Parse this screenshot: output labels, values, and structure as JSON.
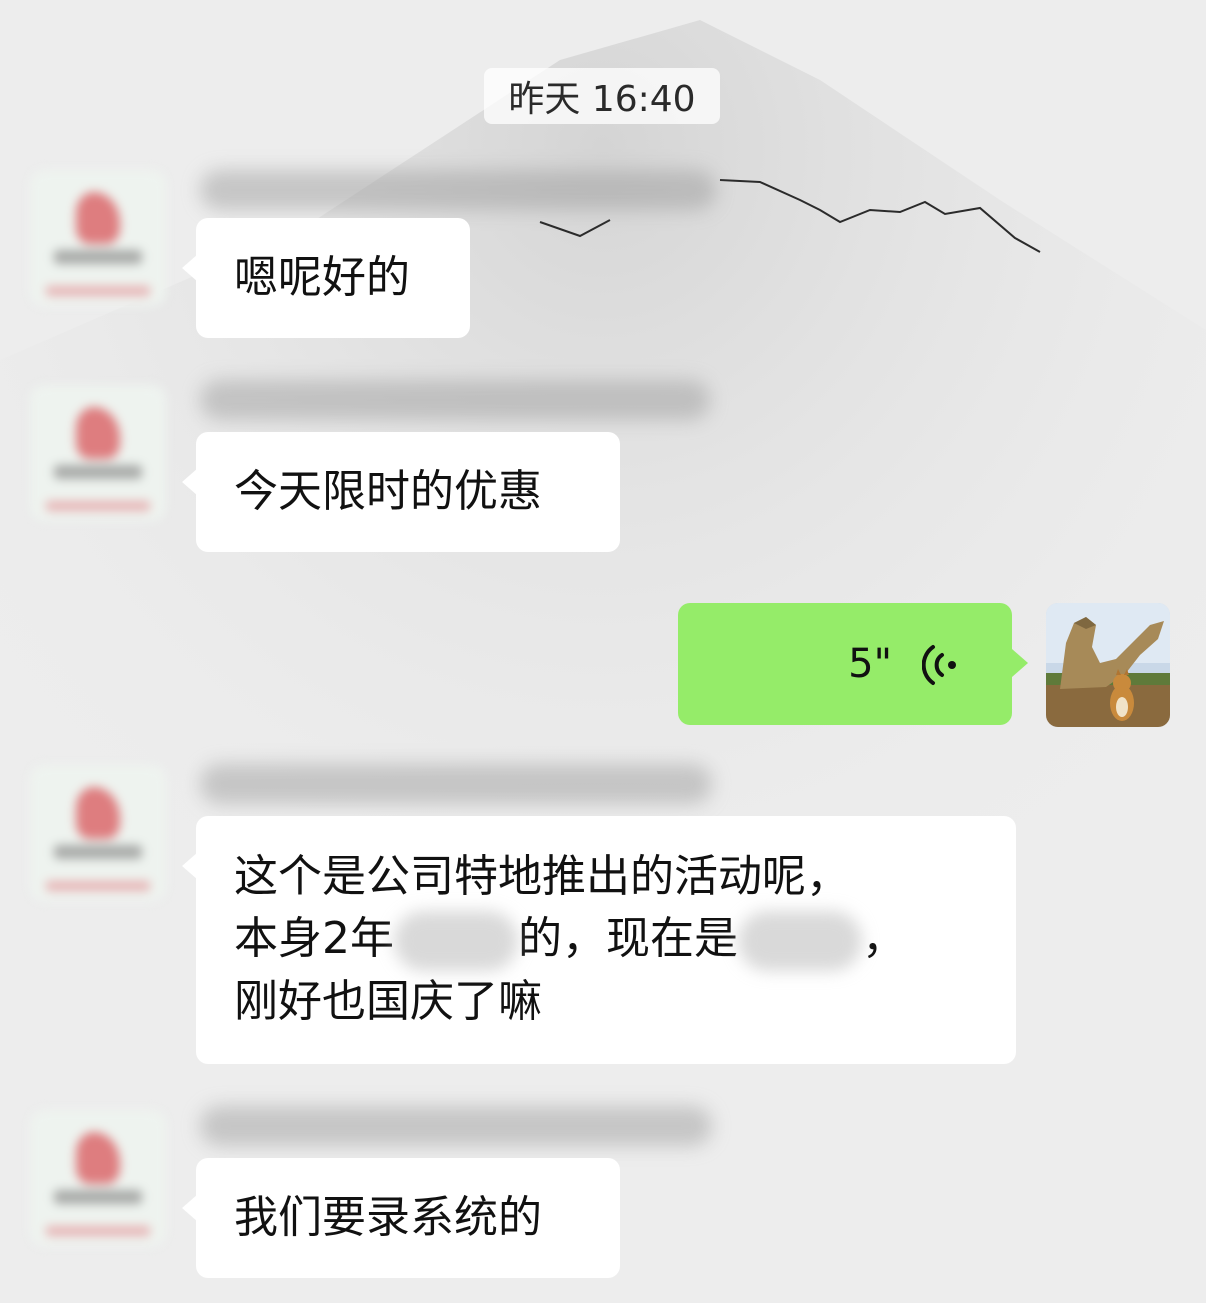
{
  "chat": {
    "timestamp": "昨天 16:40",
    "messages": [
      {
        "from": "other",
        "type": "text",
        "text": "嗯呢好的"
      },
      {
        "from": "other",
        "type": "text",
        "text": "今天限时的优惠"
      },
      {
        "from": "me",
        "type": "voice",
        "duration": "5\""
      },
      {
        "from": "other",
        "type": "text",
        "lines": [
          "这个是公司特地推出的活动呢，",
          "本身2年",
          "的，现在是",
          "，",
          "刚好也国庆了嘛"
        ]
      },
      {
        "from": "other",
        "type": "text",
        "text": "我们要录系统的"
      }
    ]
  },
  "icons": {
    "voice": "voice-wave-icon",
    "avatar_other": "company-logo-avatar",
    "avatar_me": "dog-photo-avatar"
  },
  "colors": {
    "background": "#ededed",
    "received_bubble": "#ffffff",
    "sent_bubble": "#95ec69"
  }
}
